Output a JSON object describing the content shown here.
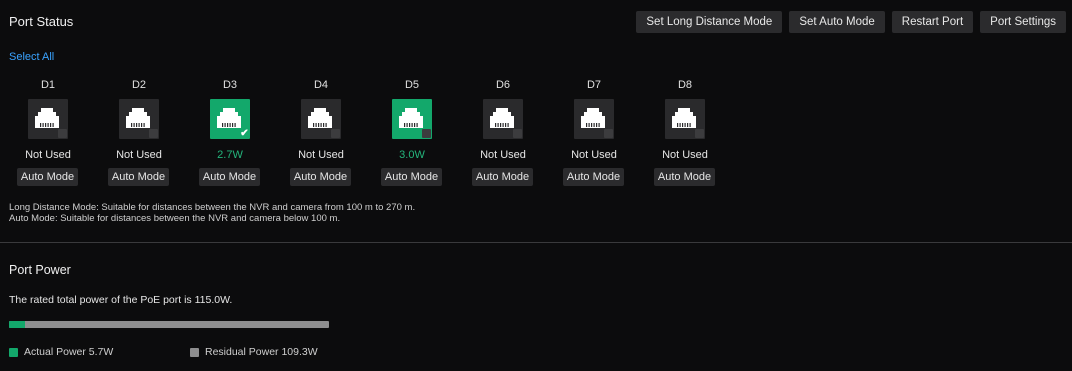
{
  "header": {
    "title": "Port Status",
    "buttons": {
      "long_distance": "Set Long Distance Mode",
      "auto": "Set Auto Mode",
      "restart": "Restart Port",
      "settings": "Port Settings"
    },
    "select_all": "Select All"
  },
  "ports": [
    {
      "name": "D1",
      "status": "Not Used",
      "mode": "Auto Mode",
      "active": false
    },
    {
      "name": "D2",
      "status": "Not Used",
      "mode": "Auto Mode",
      "active": false
    },
    {
      "name": "D3",
      "status": "2.7W",
      "mode": "Auto Mode",
      "active": true,
      "checked": true
    },
    {
      "name": "D4",
      "status": "Not Used",
      "mode": "Auto Mode",
      "active": false
    },
    {
      "name": "D5",
      "status": "3.0W",
      "mode": "Auto Mode",
      "active": true,
      "checked": false
    },
    {
      "name": "D6",
      "status": "Not Used",
      "mode": "Auto Mode",
      "active": false
    },
    {
      "name": "D7",
      "status": "Not Used",
      "mode": "Auto Mode",
      "active": false
    },
    {
      "name": "D8",
      "status": "Not Used",
      "mode": "Auto Mode",
      "active": false
    }
  ],
  "notes": {
    "long_distance": "Long Distance Mode: Suitable for distances between the NVR and camera from 100 m to 270 m.",
    "auto": "Auto Mode: Suitable for distances between the NVR and camera below 100 m."
  },
  "port_power": {
    "title": "Port Power",
    "rated_text": "The rated total power of the PoE port is 115.0W.",
    "used_fraction": 0.0496,
    "legend": {
      "actual": "Actual Power 5.7W",
      "residual": "Residual Power 109.3W"
    }
  },
  "colors": {
    "accent_green": "#13a86b",
    "link_blue": "#3aa3ff",
    "residual_gray": "#8e8e8f"
  },
  "icons": {
    "port": "ethernet-port-icon",
    "check": "checkmark-icon"
  }
}
